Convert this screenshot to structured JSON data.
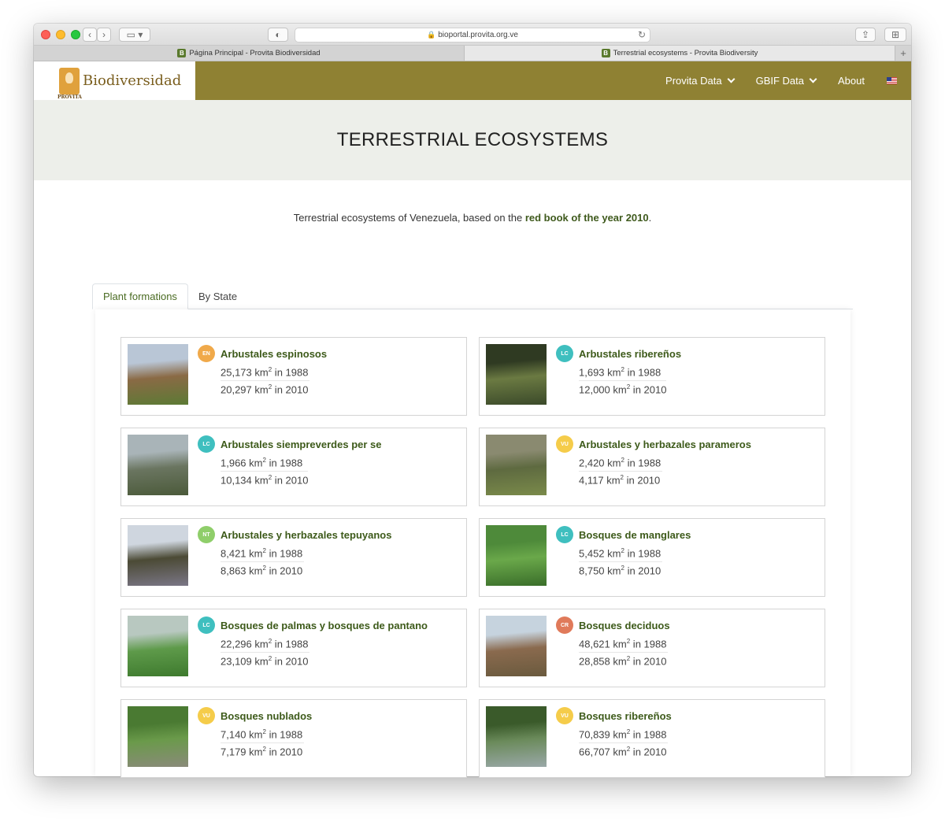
{
  "browser": {
    "url": "bioportal.provita.org.ve",
    "tabs": [
      {
        "label": "Página Principal - Provita Biodiversidad",
        "active": false
      },
      {
        "label": "Terrestrial ecosystems - Provita Biodiversity",
        "active": true
      }
    ],
    "favicon_letter": "B"
  },
  "header": {
    "brand": "Biodiversidad",
    "brand_sub": "PROVITA",
    "nav": [
      {
        "label": "Provita Data",
        "dropdown": true
      },
      {
        "label": "GBIF Data",
        "dropdown": true
      },
      {
        "label": "About",
        "dropdown": false
      }
    ],
    "nav_color": "#8f8133"
  },
  "page": {
    "title": "TERRESTRIAL ECOSYSTEMS",
    "intro_before": "Terrestrial ecosystems of Venezuela, based on the ",
    "intro_link": "red book of the year 2010",
    "intro_after": "."
  },
  "tabs": [
    {
      "label": "Plant formations",
      "active": true
    },
    {
      "label": "By State",
      "active": false
    }
  ],
  "unit": "km",
  "unit_exp": "2",
  "ecosystems": [
    {
      "name": "Arbustales espinosos",
      "status": "EN",
      "status_color": "#f0a94a",
      "y1988": "25,173",
      "y2010": "20,297",
      "image_colors": [
        "#b9c6d6",
        "#8a6a45",
        "#5c7a35"
      ]
    },
    {
      "name": "Arbustales ribereños",
      "status": "LC",
      "status_color": "#3fbfbf",
      "y1988": "1,693",
      "y2010": "12,000",
      "image_colors": [
        "#2f3a22",
        "#6b7a42",
        "#3b4a2a"
      ]
    },
    {
      "name": "Arbustales siempreverdes per se",
      "status": "LC",
      "status_color": "#3fbfbf",
      "y1988": "1,966",
      "y2010": "10,134",
      "image_colors": [
        "#a9b4b8",
        "#6a7560",
        "#4b5a3a"
      ]
    },
    {
      "name": "Arbustales y herbazales parameros",
      "status": "VU",
      "status_color": "#f5cc4a",
      "y1988": "2,420",
      "y2010": "4,117",
      "image_colors": [
        "#8a8a70",
        "#5e6a40",
        "#7a8a4a"
      ]
    },
    {
      "name": "Arbustales y herbazales tepuyanos",
      "status": "NT",
      "status_color": "#8fce6a",
      "y1988": "8,421",
      "y2010": "8,863",
      "image_colors": [
        "#cfd6df",
        "#4b4a35",
        "#7a7686"
      ]
    },
    {
      "name": "Bosques de manglares",
      "status": "LC",
      "status_color": "#3fbfbf",
      "y1988": "5,452",
      "y2010": "8,750",
      "image_colors": [
        "#4e8a3a",
        "#6aa84a",
        "#3a6e2a"
      ]
    },
    {
      "name": "Bosques de palmas y bosques de pantano",
      "status": "LC",
      "status_color": "#3fbfbf",
      "y1988": "22,296",
      "y2010": "23,109",
      "image_colors": [
        "#b8c8c0",
        "#5e9a4a",
        "#3e7a2e"
      ]
    },
    {
      "name": "Bosques deciduos",
      "status": "CR",
      "status_color": "#e07a5a",
      "y1988": "48,621",
      "y2010": "28,858",
      "image_colors": [
        "#c6d3de",
        "#8a6a4e",
        "#6a5a3e"
      ]
    },
    {
      "name": "Bosques nublados",
      "status": "VU",
      "status_color": "#f5cc4a",
      "y1988": "7,140",
      "y2010": "7,179",
      "image_colors": [
        "#4a7a32",
        "#6a9a4a",
        "#8a8a7a"
      ]
    },
    {
      "name": "Bosques ribereños",
      "status": "VU",
      "status_color": "#f5cc4a",
      "y1988": "70,839",
      "y2010": "66,707",
      "image_colors": [
        "#3a5a2a",
        "#6a8a5a",
        "#9aa8a8"
      ]
    }
  ]
}
